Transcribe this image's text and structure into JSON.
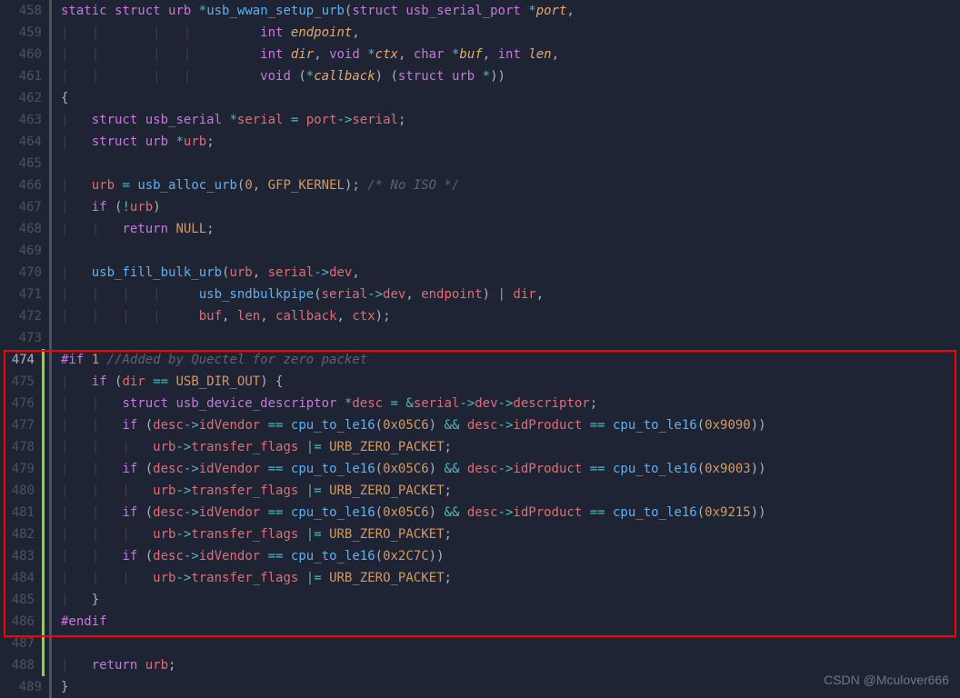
{
  "watermark": "CSDN @Mculover666",
  "gutter": {
    "start": 458,
    "end": 489,
    "active": 474,
    "changed_start": 474,
    "changed_end": 488
  },
  "lines": [
    {
      "n": 458,
      "html": "<span class='kw'>static</span> <span class='kw'>struct</span> <span class='type'>urb</span> <span class='op'>*</span><span class='fn'>usb_wwan_setup_urb</span><span class='punc'>(</span><span class='kw'>struct</span> <span class='type'>usb_serial_port</span> <span class='op'>*</span><span class='param'>port</span><span class='punc'>,</span>"
    },
    {
      "n": 459,
      "html": "<span class='guide'>|   |       |   |   </span>      <span class='type'>int</span> <span class='param'>endpoint</span><span class='punc'>,</span>"
    },
    {
      "n": 460,
      "html": "<span class='guide'>|   |       |   |   </span>      <span class='type'>int</span> <span class='param'>dir</span><span class='punc'>,</span> <span class='type'>void</span> <span class='op'>*</span><span class='param'>ctx</span><span class='punc'>,</span> <span class='type'>char</span> <span class='op'>*</span><span class='param'>buf</span><span class='punc'>,</span> <span class='type'>int</span> <span class='param'>len</span><span class='punc'>,</span>"
    },
    {
      "n": 461,
      "html": "<span class='guide'>|   |       |   |   </span>      <span class='type'>void</span> <span class='punc'>(</span><span class='op'>*</span><span class='param'>callback</span><span class='punc'>) (</span><span class='kw'>struct</span> <span class='type'>urb</span> <span class='op'>*</span><span class='punc'>))</span>"
    },
    {
      "n": 462,
      "html": "<span class='punc'>{</span>"
    },
    {
      "n": 463,
      "html": "<span class='guide'>|   </span><span class='kw'>struct</span> <span class='type'>usb_serial</span> <span class='op'>*</span><span class='var'>serial</span> <span class='op'>=</span> <span class='var'>port</span><span class='op'>-&gt;</span><span class='prop'>serial</span><span class='punc'>;</span>"
    },
    {
      "n": 464,
      "html": "<span class='guide'>|   </span><span class='kw'>struct</span> <span class='type'>urb</span> <span class='op'>*</span><span class='var'>urb</span><span class='punc'>;</span>"
    },
    {
      "n": 465,
      "html": ""
    },
    {
      "n": 466,
      "html": "<span class='guide'>|   </span><span class='var'>urb</span> <span class='op'>=</span> <span class='fn'>usb_alloc_urb</span><span class='punc'>(</span><span class='num'>0</span><span class='punc'>,</span> <span class='const'>GFP_KERNEL</span><span class='punc'>);</span> <span class='comment'>/* No ISO */</span>"
    },
    {
      "n": 467,
      "html": "<span class='guide'>|   </span><span class='kw'>if</span> <span class='punc'>(</span><span class='op'>!</span><span class='var'>urb</span><span class='punc'>)</span>"
    },
    {
      "n": 468,
      "html": "<span class='guide'>|   |   </span><span class='kw'>return</span> <span class='const'>NULL</span><span class='punc'>;</span>"
    },
    {
      "n": 469,
      "html": ""
    },
    {
      "n": 470,
      "html": "<span class='guide'>|   </span><span class='fn'>usb_fill_bulk_urb</span><span class='punc'>(</span><span class='var'>urb</span><span class='punc'>,</span> <span class='var'>serial</span><span class='op'>-&gt;</span><span class='prop'>dev</span><span class='punc'>,</span>"
    },
    {
      "n": 471,
      "html": "<span class='guide'>|   |   |   |   </span>  <span class='fn'>usb_sndbulkpipe</span><span class='punc'>(</span><span class='var'>serial</span><span class='op'>-&gt;</span><span class='prop'>dev</span><span class='punc'>,</span> <span class='var'>endpoint</span><span class='punc'>)</span> <span class='op'>|</span> <span class='var'>dir</span><span class='punc'>,</span>"
    },
    {
      "n": 472,
      "html": "<span class='guide'>|   |   |   |   </span>  <span class='var'>buf</span><span class='punc'>,</span> <span class='var'>len</span><span class='punc'>,</span> <span class='var'>callback</span><span class='punc'>,</span> <span class='var'>ctx</span><span class='punc'>);</span>"
    },
    {
      "n": 473,
      "html": ""
    },
    {
      "n": 474,
      "html": "<span class='pp'>#if</span> <span class='num'>1</span> <span class='comment'>//Added by Quectel for zero packet</span>"
    },
    {
      "n": 475,
      "html": "<span class='guide'>|   </span><span class='kw'>if</span> <span class='punc'>(</span><span class='var'>dir</span> <span class='op'>==</span> <span class='const'>USB_DIR_OUT</span><span class='punc'>) {</span>"
    },
    {
      "n": 476,
      "html": "<span class='guide'>|   |   </span><span class='kw'>struct</span> <span class='type'>usb_device_descriptor</span> <span class='op'>*</span><span class='var'>desc</span> <span class='op'>=</span> <span class='op'>&amp;</span><span class='var'>serial</span><span class='op'>-&gt;</span><span class='prop'>dev</span><span class='op'>-&gt;</span><span class='prop'>descriptor</span><span class='punc'>;</span>"
    },
    {
      "n": 477,
      "html": "<span class='guide'>|   |   </span><span class='kw'>if</span> <span class='punc'>(</span><span class='var'>desc</span><span class='op'>-&gt;</span><span class='prop'>idVendor</span> <span class='op'>==</span> <span class='fn'>cpu_to_le16</span><span class='punc'>(</span><span class='num'>0x05C6</span><span class='punc'>)</span> <span class='op'>&amp;&amp;</span> <span class='var'>desc</span><span class='op'>-&gt;</span><span class='prop'>idProduct</span> <span class='op'>==</span> <span class='fn'>cpu_to_le16</span><span class='punc'>(</span><span class='num'>0x9090</span><span class='punc'>))</span>"
    },
    {
      "n": 478,
      "html": "<span class='guide'>|   |   |   </span><span class='var'>urb</span><span class='op'>-&gt;</span><span class='prop'>transfer_flags</span> <span class='op'>|=</span> <span class='const'>URB_ZERO_PACKET</span><span class='punc'>;</span>"
    },
    {
      "n": 479,
      "html": "<span class='guide'>|   |   </span><span class='kw'>if</span> <span class='punc'>(</span><span class='var'>desc</span><span class='op'>-&gt;</span><span class='prop'>idVendor</span> <span class='op'>==</span> <span class='fn'>cpu_to_le16</span><span class='punc'>(</span><span class='num'>0x05C6</span><span class='punc'>)</span> <span class='op'>&amp;&amp;</span> <span class='var'>desc</span><span class='op'>-&gt;</span><span class='prop'>idProduct</span> <span class='op'>==</span> <span class='fn'>cpu_to_le16</span><span class='punc'>(</span><span class='num'>0x9003</span><span class='punc'>))</span>"
    },
    {
      "n": 480,
      "html": "<span class='guide'>|   |   |   </span><span class='var'>urb</span><span class='op'>-&gt;</span><span class='prop'>transfer_flags</span> <span class='op'>|=</span> <span class='const'>URB_ZERO_PACKET</span><span class='punc'>;</span>"
    },
    {
      "n": 481,
      "html": "<span class='guide'>|   |   </span><span class='kw'>if</span> <span class='punc'>(</span><span class='var'>desc</span><span class='op'>-&gt;</span><span class='prop'>idVendor</span> <span class='op'>==</span> <span class='fn'>cpu_to_le16</span><span class='punc'>(</span><span class='num'>0x05C6</span><span class='punc'>)</span> <span class='op'>&amp;&amp;</span> <span class='var'>desc</span><span class='op'>-&gt;</span><span class='prop'>idProduct</span> <span class='op'>==</span> <span class='fn'>cpu_to_le16</span><span class='punc'>(</span><span class='num'>0x9215</span><span class='punc'>))</span>"
    },
    {
      "n": 482,
      "html": "<span class='guide'>|   |   |   </span><span class='var'>urb</span><span class='op'>-&gt;</span><span class='prop'>transfer_flags</span> <span class='op'>|=</span> <span class='const'>URB_ZERO_PACKET</span><span class='punc'>;</span>"
    },
    {
      "n": 483,
      "html": "<span class='guide'>|   |   </span><span class='kw'>if</span> <span class='punc'>(</span><span class='var'>desc</span><span class='op'>-&gt;</span><span class='prop'>idVendor</span> <span class='op'>==</span> <span class='fn'>cpu_to_le16</span><span class='punc'>(</span><span class='num'>0x2C7C</span><span class='punc'>))</span>"
    },
    {
      "n": 484,
      "html": "<span class='guide'>|   |   |   </span><span class='var'>urb</span><span class='op'>-&gt;</span><span class='prop'>transfer_flags</span> <span class='op'>|=</span> <span class='const'>URB_ZERO_PACKET</span><span class='punc'>;</span>"
    },
    {
      "n": 485,
      "html": "<span class='guide'>|   </span><span class='punc'>}</span>"
    },
    {
      "n": 486,
      "html": "<span class='pp'>#endif</span>"
    },
    {
      "n": 487,
      "html": ""
    },
    {
      "n": 488,
      "html": "<span class='guide'>|   </span><span class='kw'>return</span> <span class='var'>urb</span><span class='punc'>;</span>"
    },
    {
      "n": 489,
      "html": "<span class='punc'>}</span>"
    }
  ]
}
